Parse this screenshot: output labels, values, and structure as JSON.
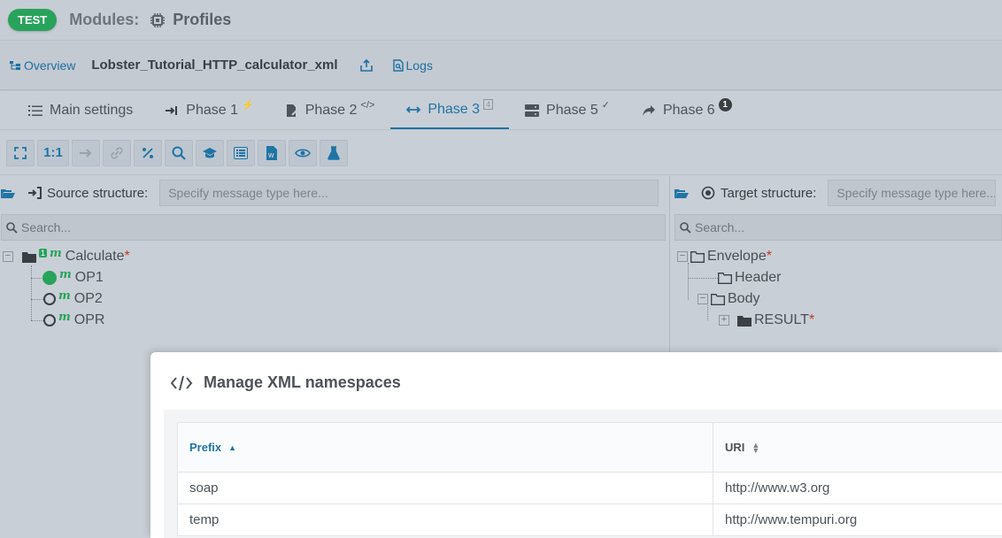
{
  "header": {
    "env_badge": "TEST",
    "modules_label": "Modules:",
    "profiles_label": "Profiles"
  },
  "titlebar": {
    "overview_label": "Overview",
    "profile_name": "Lobster_Tutorial_HTTP_calculator_xml",
    "logs_label": "Logs"
  },
  "tabs": [
    {
      "label": "Main settings",
      "suffix": ""
    },
    {
      "label": "Phase 1",
      "suffix": "⚡"
    },
    {
      "label": "Phase 2",
      "suffix": "</>"
    },
    {
      "label": "Phase 3",
      "suffix": "4"
    },
    {
      "label": "Phase 5",
      "suffix": "✓"
    },
    {
      "label": "Phase 6",
      "suffix": "1"
    }
  ],
  "toolbar": {
    "ratio_label": "1:1"
  },
  "source": {
    "label": "Source structure:",
    "placeholder": "Specify message type here...",
    "search_placeholder": "Search...",
    "root": {
      "name": "Calculate",
      "required": "*",
      "count": "1",
      "badge": "m"
    },
    "children": [
      {
        "name": "OP1",
        "badge": "m",
        "mapped": true
      },
      {
        "name": "OP2",
        "badge": "m",
        "mapped": false
      },
      {
        "name": "OPR",
        "badge": "m",
        "mapped": false
      }
    ]
  },
  "target": {
    "label": "Target structure:",
    "placeholder": "Specify message type here...",
    "search_placeholder": "Search...",
    "nodes": {
      "envelope": "Envelope",
      "envelope_req": "*",
      "header": "Header",
      "body": "Body",
      "result": "RESULT",
      "result_req": "*"
    }
  },
  "modal": {
    "title": "Manage XML namespaces",
    "columns": {
      "prefix": "Prefix",
      "uri": "URI"
    },
    "rows": [
      {
        "prefix": "soap",
        "uri": "http://www.w3.org"
      },
      {
        "prefix": "temp",
        "uri": "http://www.tempuri.org"
      }
    ]
  },
  "colors": {
    "accent": "#1f74a6",
    "success": "#28a35c",
    "required": "#c0392b"
  }
}
